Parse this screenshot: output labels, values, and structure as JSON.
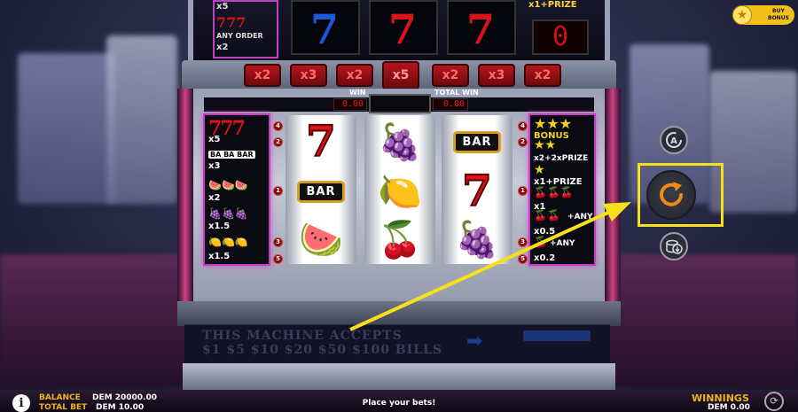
{
  "buy_bonus": {
    "label": "BUY BONUS",
    "line1": "BUY",
    "line2": "BONUS",
    "icon": "star-icon"
  },
  "top_panel": {
    "left_pay_top": "x5",
    "left_pay_label": "ANY ORDER",
    "left_pay_mult": "x2",
    "right_pay": "x1+PRIZE",
    "counter": "0"
  },
  "multipliers": [
    "x2",
    "x3",
    "x2",
    "x5",
    "x2",
    "x3",
    "x2"
  ],
  "win_display": {
    "win_label": "WIN",
    "total_win_label": "TOTAL WIN",
    "win_value": "0.00",
    "total_win_value": "0.00"
  },
  "left_paytable": [
    {
      "symbol": "777",
      "mult": "x5"
    },
    {
      "symbol": "BA BA BAR",
      "mult": "x3"
    },
    {
      "symbol": "watermelons",
      "mult": "x2"
    },
    {
      "symbol": "grapes",
      "mult": "x1.5"
    },
    {
      "symbol": "lemons",
      "mult": "x1.5"
    }
  ],
  "right_paytable": [
    {
      "label": "BONUS"
    },
    {
      "label": "x2+2xPRIZE"
    },
    {
      "label": "x1+PRIZE"
    },
    {
      "label": "x1"
    },
    {
      "label": "+ANY"
    },
    {
      "label": "x0.5"
    },
    {
      "label": "+ANY"
    },
    {
      "label": "x0.2"
    }
  ],
  "reels": [
    [
      "seven",
      "bar",
      "watermelon"
    ],
    [
      "grapes",
      "lemon",
      "cherries"
    ],
    [
      "bar",
      "seven",
      "grapes"
    ]
  ],
  "bar_text": "BAR",
  "bill_panel": {
    "line1": "THIS MACHINE ACCEPTS",
    "line2": "$1 $5 $10 $20 $50 $100 BILLS"
  },
  "bottom": {
    "balance_label": "BALANCE",
    "balance_value": "DEM 20000.00",
    "total_bet_label": "TOTAL BET",
    "total_bet_value": "DEM 10.00",
    "status": "Place your bets!",
    "winnings_label": "WINNINGS",
    "winnings_value": "DEM 0.00"
  },
  "controls": {
    "autoplay_icon": "autoplay-icon",
    "spin_icon": "spin-refresh-icon",
    "bet_icon": "coin-stack-icon"
  },
  "colors": {
    "accent": "#f5e11b",
    "spin_orange": "#f08a14",
    "reel_red": "#d8141a"
  }
}
